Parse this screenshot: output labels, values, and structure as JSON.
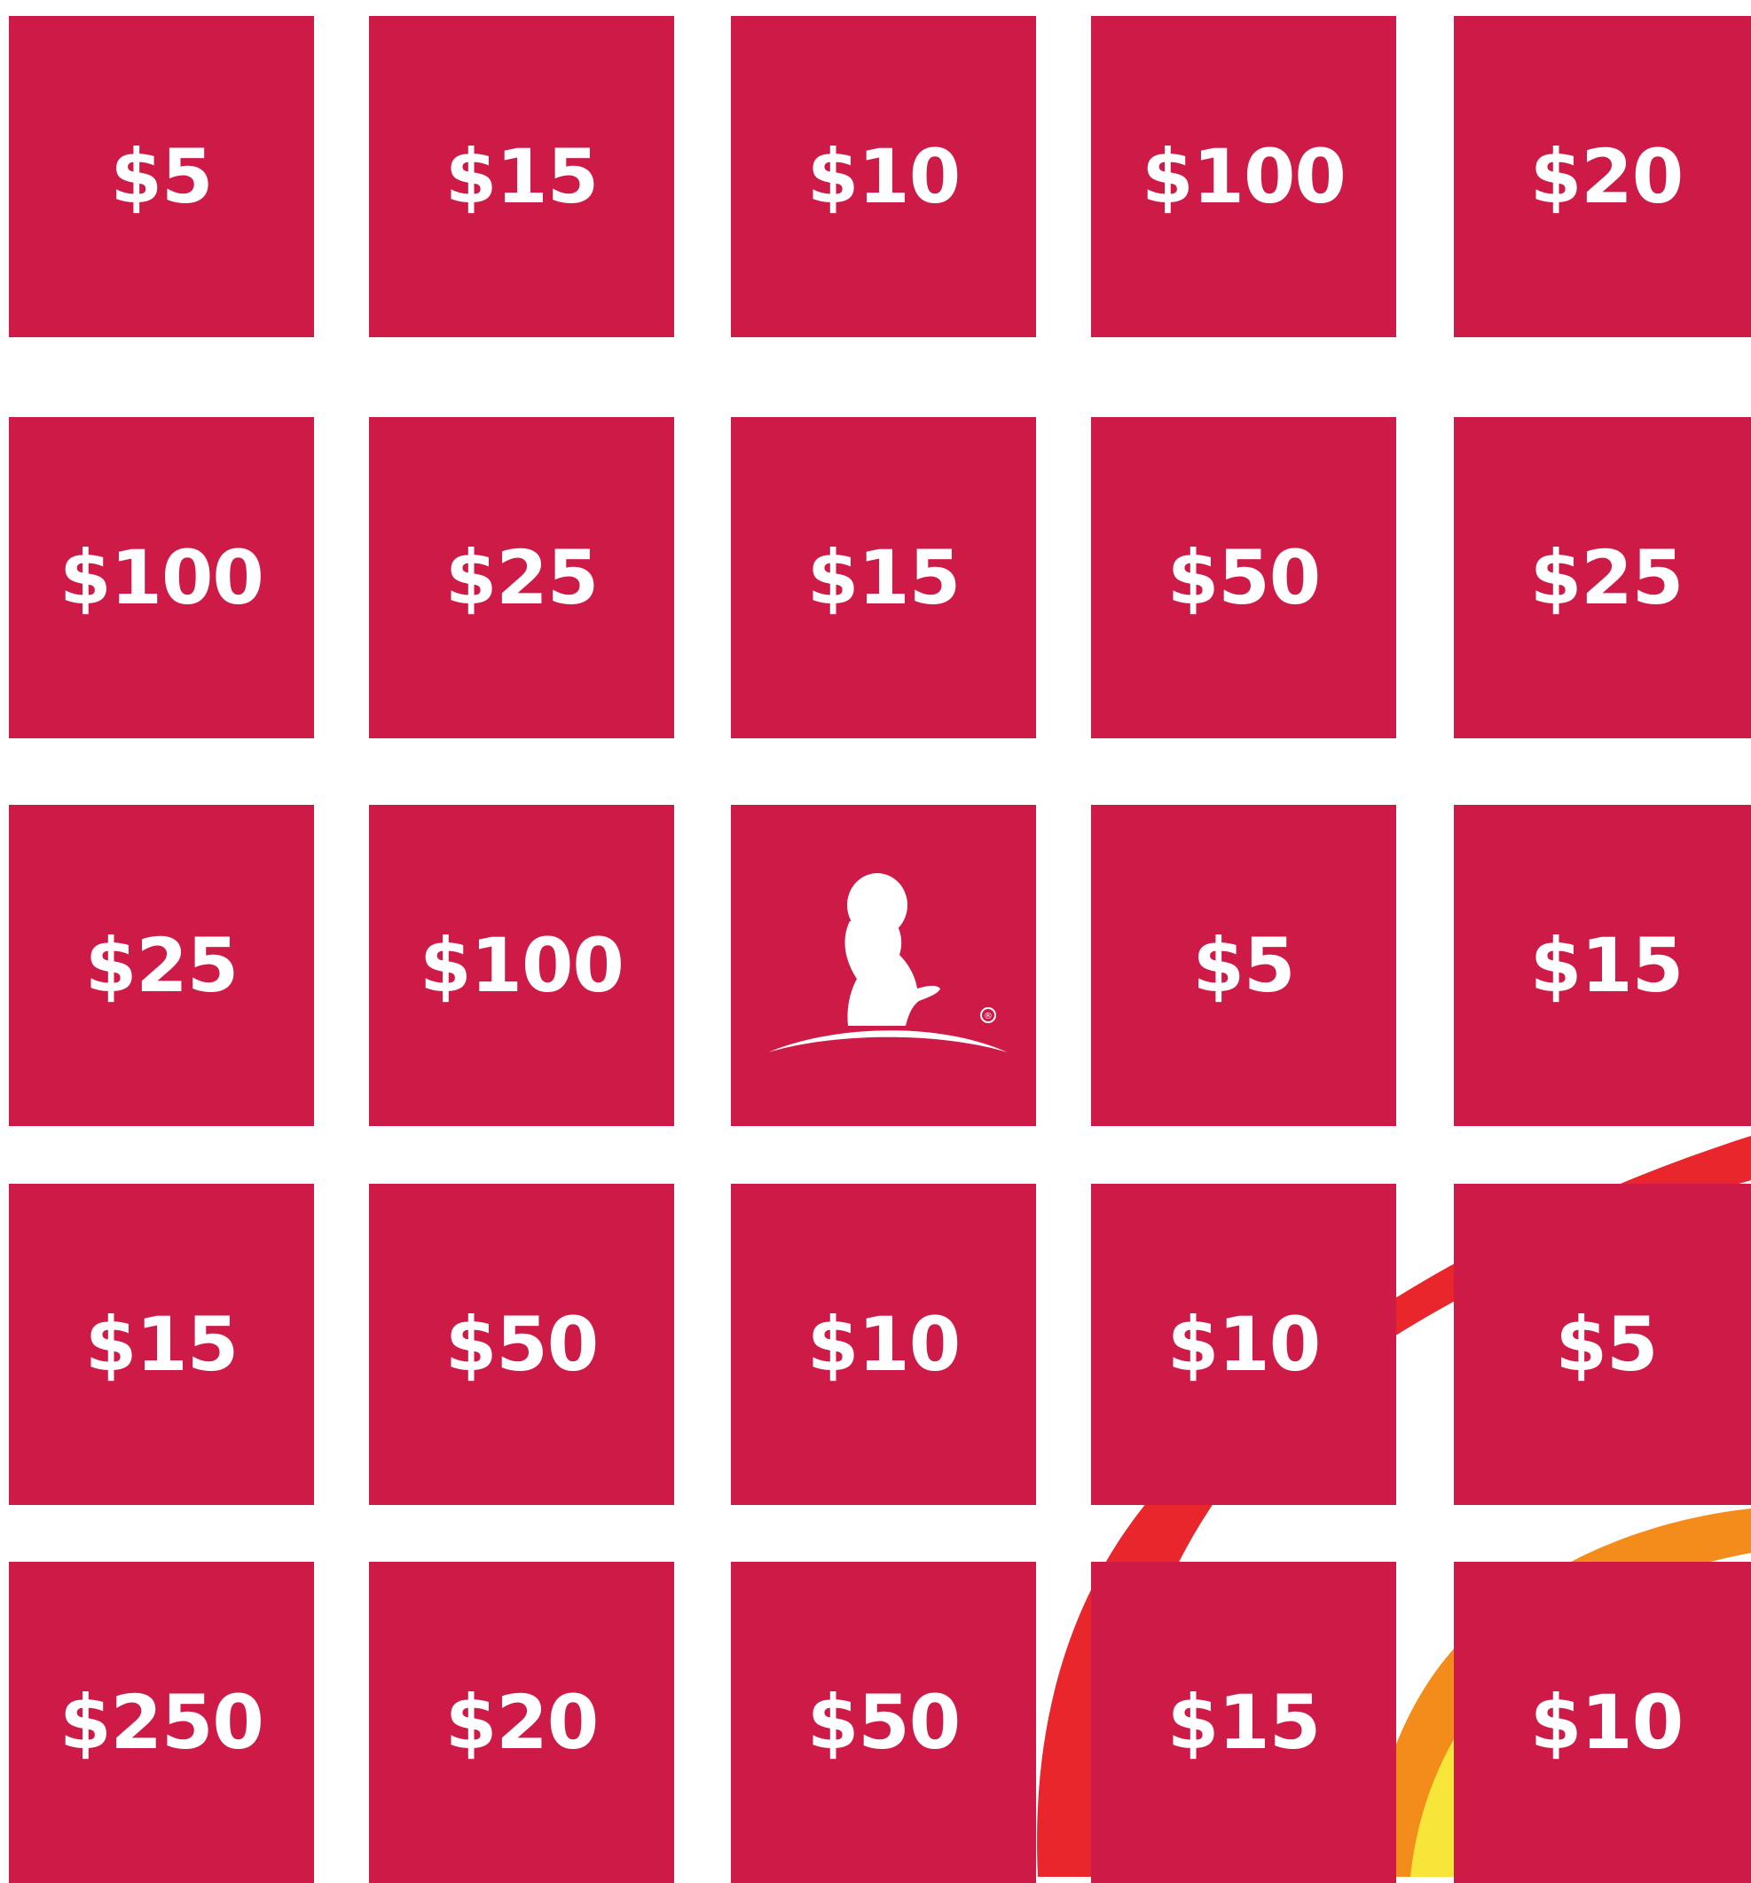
{
  "colors": {
    "tile": "#CE1A46",
    "background": "#FFFFFF",
    "tile_text": "#FFFFFF",
    "brush_red": "#E8262B",
    "brush_orange": "#F48C1B",
    "brush_yellow": "#F7E53A"
  },
  "grid": {
    "rows": [
      {
        "tiles": [
          {
            "label": "$5"
          },
          {
            "label": "$15"
          },
          {
            "label": "$10"
          },
          {
            "label": "$100"
          },
          {
            "label": "$20"
          }
        ]
      },
      {
        "tiles": [
          {
            "label": "$100"
          },
          {
            "label": "$25"
          },
          {
            "label": "$15"
          },
          {
            "label": "$50"
          },
          {
            "label": "$25"
          }
        ]
      },
      {
        "tiles": [
          {
            "label": "$25"
          },
          {
            "label": "$100"
          },
          {
            "icon": "child-silhouette-logo-icon"
          },
          {
            "label": "$5"
          },
          {
            "label": "$15"
          }
        ]
      },
      {
        "tiles": [
          {
            "label": "$15"
          },
          {
            "label": "$50"
          },
          {
            "label": "$10"
          },
          {
            "label": "$10"
          },
          {
            "label": "$5"
          }
        ]
      },
      {
        "tiles": [
          {
            "label": "$250"
          },
          {
            "label": "$20"
          },
          {
            "label": "$50"
          },
          {
            "label": "$15"
          },
          {
            "label": "$10"
          }
        ]
      }
    ]
  }
}
